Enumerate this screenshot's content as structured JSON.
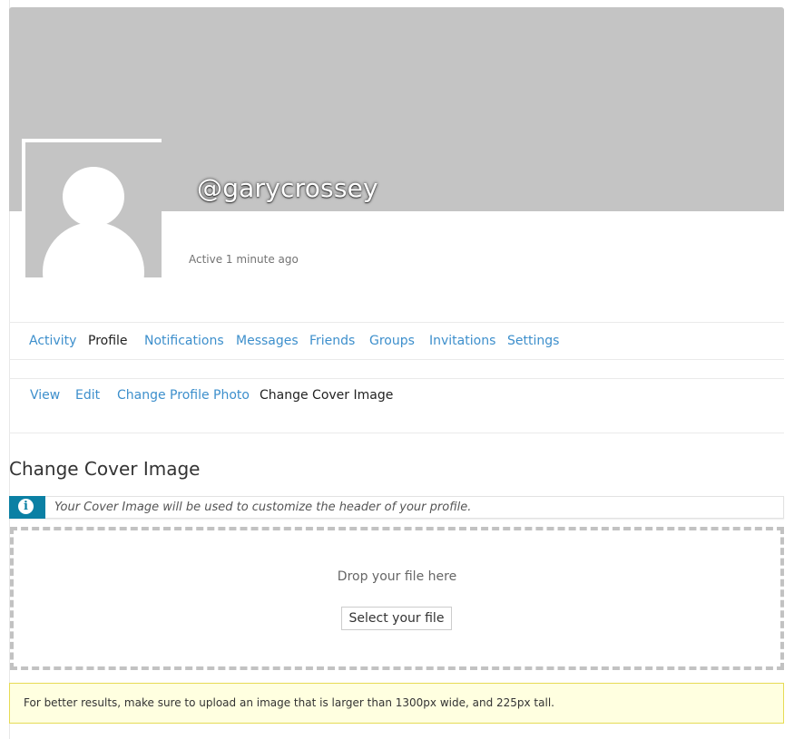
{
  "profile": {
    "username": "@garycrossey",
    "activity": "Active 1 minute ago"
  },
  "nav_primary": [
    {
      "label": "Activity"
    },
    {
      "label": "Profile"
    },
    {
      "label": "Notifications"
    },
    {
      "label": "Messages"
    },
    {
      "label": "Friends"
    },
    {
      "label": "Groups"
    },
    {
      "label": "Invitations"
    },
    {
      "label": "Settings"
    }
  ],
  "nav_primary_current": "Profile",
  "nav_secondary": [
    {
      "label": "View"
    },
    {
      "label": "Edit"
    },
    {
      "label": "Change Profile Photo"
    },
    {
      "label": "Change Cover Image"
    }
  ],
  "nav_secondary_current": "Change Cover Image",
  "page": {
    "title": "Change Cover Image",
    "info_message": "Your Cover Image will be used to customize the header of your profile.",
    "info_icon": "info-icon"
  },
  "uploader": {
    "drop_text": "Drop your file here",
    "select_button": "Select your file"
  },
  "notice": {
    "text": "For better results, make sure to upload an image that is larger than 1300px wide, and 225px tall."
  },
  "colors": {
    "link": "#3d8fcc",
    "cover": "#c4c4c4",
    "info_accent": "#0b80a4",
    "notice_bg": "#ffffe0",
    "notice_border": "#e6db55"
  }
}
